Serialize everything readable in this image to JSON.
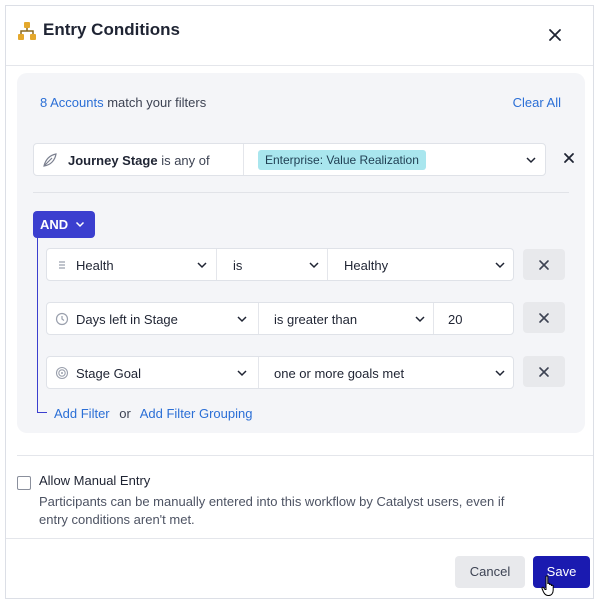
{
  "modal": {
    "title": "Entry Conditions",
    "icon": "hierarchy-icon"
  },
  "filters": {
    "match_count": "8 Accounts",
    "match_suffix": " match your filters",
    "clear_all": "Clear All",
    "journey_stage": {
      "field": "Journey Stage",
      "operator": " is any of",
      "value": "Enterprise: Value Realization",
      "tag_color": "#a9e6ee"
    },
    "group_operator": "AND",
    "rows": [
      {
        "field": "Health",
        "icon": "list-icon",
        "operator": "is",
        "value": "Healthy"
      },
      {
        "field": "Days left in Stage",
        "icon": "clock-icon",
        "operator": "is greater than",
        "value": "20"
      },
      {
        "field": "Stage Goal",
        "icon": "target-icon",
        "operator": "one or more goals met"
      }
    ],
    "add_filter": "Add Filter",
    "or": "or",
    "add_filter_grouping": "Add Filter Grouping"
  },
  "manual_entry": {
    "title": "Allow Manual Entry",
    "checked": false,
    "description": "Participants can be manually entered into this workflow by Catalyst users, even if entry conditions aren't met."
  },
  "footer": {
    "cancel": "Cancel",
    "save": "Save"
  },
  "colors": {
    "accent": "#3b3fcf",
    "save": "#1a1ab0",
    "link": "#2b6fd6"
  }
}
